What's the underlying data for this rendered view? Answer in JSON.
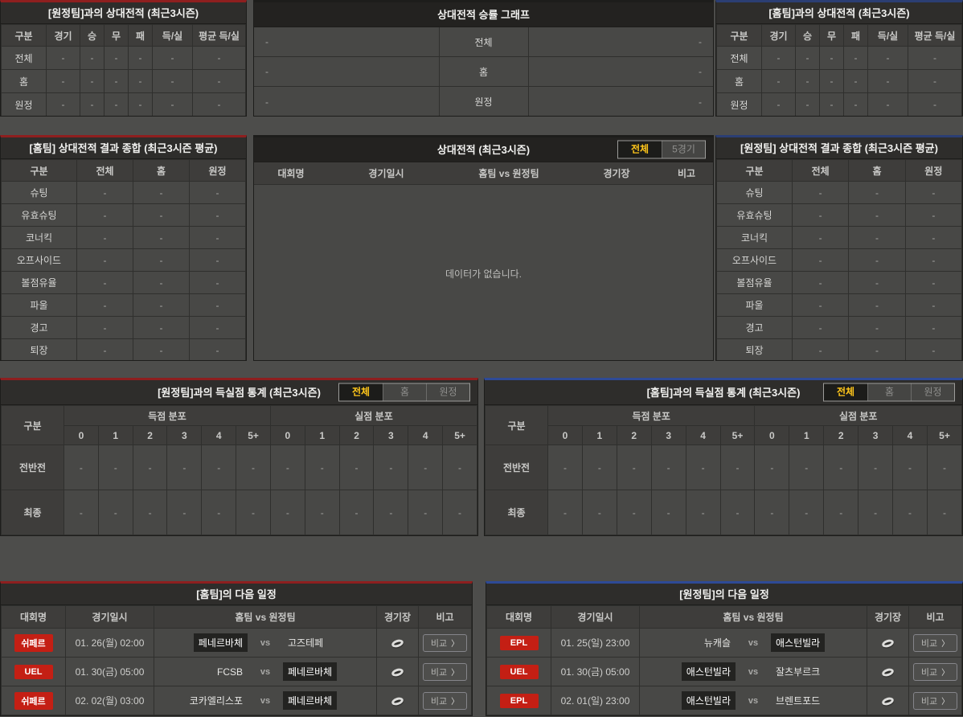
{
  "colors": {
    "accent_red": "#8e1f1f",
    "accent_navy": "#2b3e73",
    "accent_blue": "#2e4a96",
    "badge_red": "#c41f14",
    "tab_active_text": "#ffc61a"
  },
  "labels": {
    "vs": "vs"
  },
  "h2h_away": {
    "title": "[원정팀]과의 상대전적 (최근3시즌)",
    "columns": [
      "구분",
      "경기",
      "승",
      "무",
      "패",
      "득/실",
      "평균 득/실"
    ],
    "rows": [
      {
        "label": "전체",
        "v": [
          "-",
          "-",
          "-",
          "-",
          "-",
          "-"
        ]
      },
      {
        "label": "홈",
        "v": [
          "-",
          "-",
          "-",
          "-",
          "-",
          "-"
        ]
      },
      {
        "label": "원정",
        "v": [
          "-",
          "-",
          "-",
          "-",
          "-",
          "-"
        ]
      }
    ]
  },
  "winrate": {
    "title": "상대전적 승률 그래프",
    "rows": [
      {
        "label": "전체",
        "left": "-",
        "right": "-"
      },
      {
        "label": "홈",
        "left": "-",
        "right": "-"
      },
      {
        "label": "원정",
        "left": "-",
        "right": "-"
      }
    ]
  },
  "h2h_home": {
    "title": "[홈팀]과의 상대전적 (최근3시즌)",
    "columns": [
      "구분",
      "경기",
      "승",
      "무",
      "패",
      "득/실",
      "평균 득/실"
    ],
    "rows": [
      {
        "label": "전체",
        "v": [
          "-",
          "-",
          "-",
          "-",
          "-",
          "-"
        ]
      },
      {
        "label": "홈",
        "v": [
          "-",
          "-",
          "-",
          "-",
          "-",
          "-"
        ]
      },
      {
        "label": "원정",
        "v": [
          "-",
          "-",
          "-",
          "-",
          "-",
          "-"
        ]
      }
    ]
  },
  "summary_home": {
    "title": "[홈팀] 상대전적 결과 종합 (최근3시즌 평균)",
    "columns": [
      "구분",
      "전체",
      "홈",
      "원정"
    ],
    "rows": [
      {
        "label": "슈팅",
        "v": [
          "-",
          "-",
          "-"
        ]
      },
      {
        "label": "유효슈팅",
        "v": [
          "-",
          "-",
          "-"
        ]
      },
      {
        "label": "코너킥",
        "v": [
          "-",
          "-",
          "-"
        ]
      },
      {
        "label": "오프사이드",
        "v": [
          "-",
          "-",
          "-"
        ]
      },
      {
        "label": "볼점유율",
        "v": [
          "-",
          "-",
          "-"
        ]
      },
      {
        "label": "파울",
        "v": [
          "-",
          "-",
          "-"
        ]
      },
      {
        "label": "경고",
        "v": [
          "-",
          "-",
          "-"
        ]
      },
      {
        "label": "퇴장",
        "v": [
          "-",
          "-",
          "-"
        ]
      }
    ]
  },
  "matches": {
    "title": "상대전적 (최근3시즌)",
    "tabs": [
      "전체",
      "5경기"
    ],
    "columns": [
      "대회명",
      "경기일시",
      "홈팀  vs  원정팀",
      "경기장",
      "비고"
    ],
    "empty": "데이터가 없습니다."
  },
  "summary_away": {
    "title": "[원정팀] 상대전적 결과 종합 (최근3시즌 평균)",
    "columns": [
      "구분",
      "전체",
      "홈",
      "원정"
    ],
    "rows": [
      {
        "label": "슈팅",
        "v": [
          "-",
          "-",
          "-"
        ]
      },
      {
        "label": "유효슈팅",
        "v": [
          "-",
          "-",
          "-"
        ]
      },
      {
        "label": "코너킥",
        "v": [
          "-",
          "-",
          "-"
        ]
      },
      {
        "label": "오프사이드",
        "v": [
          "-",
          "-",
          "-"
        ]
      },
      {
        "label": "볼점유율",
        "v": [
          "-",
          "-",
          "-"
        ]
      },
      {
        "label": "파울",
        "v": [
          "-",
          "-",
          "-"
        ]
      },
      {
        "label": "경고",
        "v": [
          "-",
          "-",
          "-"
        ]
      },
      {
        "label": "퇴장",
        "v": [
          "-",
          "-",
          "-"
        ]
      }
    ]
  },
  "goals_left": {
    "title": "[원정팀]과의 득실점 통계 (최근3시즌)",
    "tabs": [
      "전체",
      "홈",
      "원정"
    ],
    "corner": "구분",
    "groups": [
      "득점 분포",
      "실점 분포"
    ],
    "bins": [
      "0",
      "1",
      "2",
      "3",
      "4",
      "5+"
    ],
    "rows": [
      {
        "label": "전반전",
        "v": [
          "-",
          "-",
          "-",
          "-",
          "-",
          "-",
          "-",
          "-",
          "-",
          "-",
          "-",
          "-"
        ]
      },
      {
        "label": "최종",
        "v": [
          "-",
          "-",
          "-",
          "-",
          "-",
          "-",
          "-",
          "-",
          "-",
          "-",
          "-",
          "-"
        ]
      }
    ]
  },
  "goals_right": {
    "title": "[홈팀]과의 득실점 통계 (최근3시즌)",
    "tabs": [
      "전체",
      "홈",
      "원정"
    ],
    "corner": "구분",
    "groups": [
      "득점 분포",
      "실점 분포"
    ],
    "bins": [
      "0",
      "1",
      "2",
      "3",
      "4",
      "5+"
    ],
    "rows": [
      {
        "label": "전반전",
        "v": [
          "-",
          "-",
          "-",
          "-",
          "-",
          "-",
          "-",
          "-",
          "-",
          "-",
          "-",
          "-"
        ]
      },
      {
        "label": "최종",
        "v": [
          "-",
          "-",
          "-",
          "-",
          "-",
          "-",
          "-",
          "-",
          "-",
          "-",
          "-",
          "-"
        ]
      }
    ]
  },
  "sched_home": {
    "title": "[홈팀]의 다음 일정",
    "columns": [
      "대회명",
      "경기일시",
      "홈팀  vs  원정팀",
      "경기장",
      "비고"
    ],
    "compare": "비교",
    "chevron": "〉",
    "rows": [
      {
        "league": "쉬페르",
        "dt": "01. 26(월) 02:00",
        "home": "페네르바체",
        "away": "고즈테페",
        "home_cls": "chip hl",
        "away_cls": "chip"
      },
      {
        "league": "UEL",
        "dt": "01. 30(금) 05:00",
        "home": "FCSB",
        "away": "페네르바체",
        "home_cls": "chip",
        "away_cls": "chip hl"
      },
      {
        "league": "쉬페르",
        "dt": "02. 02(월) 03:00",
        "home": "코카엘리스포",
        "away": "페네르바체",
        "home_cls": "chip",
        "away_cls": "chip hl"
      }
    ]
  },
  "sched_away": {
    "title": "[원정팀]의 다음 일정",
    "columns": [
      "대회명",
      "경기일시",
      "홈팀  vs  원정팀",
      "경기장",
      "비고"
    ],
    "compare": "비교",
    "chevron": "〉",
    "rows": [
      {
        "league": "EPL",
        "dt": "01. 25(일) 23:00",
        "home": "뉴캐슬",
        "away": "애스턴빌라",
        "home_cls": "chip",
        "away_cls": "chip hl"
      },
      {
        "league": "UEL",
        "dt": "01. 30(금) 05:00",
        "home": "애스턴빌라",
        "away": "잘츠부르크",
        "home_cls": "chip hl",
        "away_cls": "chip"
      },
      {
        "league": "EPL",
        "dt": "02. 01(일) 23:00",
        "home": "애스턴빌라",
        "away": "브렌트포드",
        "home_cls": "chip hl",
        "away_cls": "chip"
      }
    ]
  }
}
